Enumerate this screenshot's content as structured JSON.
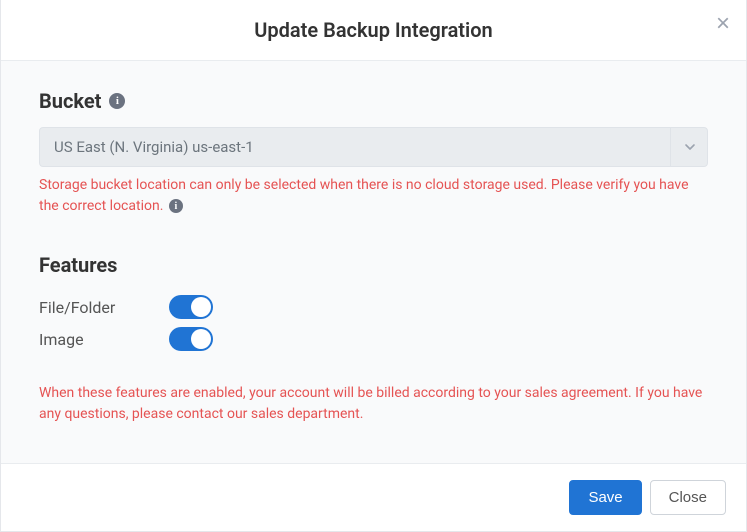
{
  "modal": {
    "title": "Update Backup Integration"
  },
  "bucket": {
    "heading": "Bucket",
    "selected": "US East (N. Virginia) us-east-1",
    "warning": "Storage bucket location can only be selected when there is no cloud storage used. Please verify you have the correct location."
  },
  "features": {
    "heading": "Features",
    "items": [
      {
        "label": "File/Folder",
        "enabled": true
      },
      {
        "label": "Image",
        "enabled": true
      }
    ],
    "billing_note": "When these features are enabled, your account will be billed according to your sales agreement. If you have any questions, please contact our sales department."
  },
  "footer": {
    "save": "Save",
    "close": "Close"
  }
}
